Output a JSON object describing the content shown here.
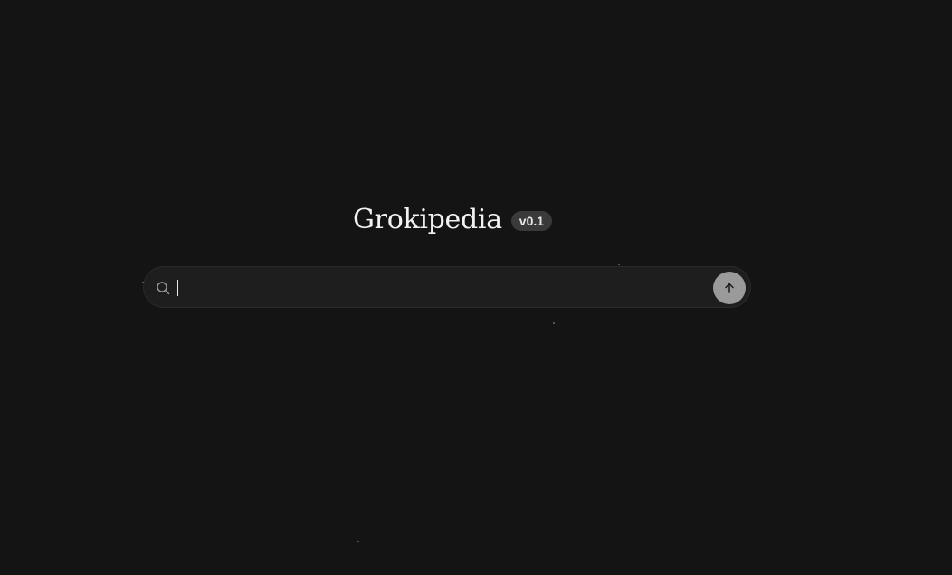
{
  "brand": {
    "title": "Grokipedia",
    "version": "v0.1"
  },
  "search": {
    "value": "",
    "placeholder": "",
    "icon": "search-icon",
    "submit_icon": "arrow-up-icon"
  },
  "colors": {
    "background": "#141414",
    "search_bg": "#1e1e1e",
    "badge_bg": "#3a3a3a",
    "submit_bg": "#9a9a9a",
    "text": "#f2f2f2"
  }
}
